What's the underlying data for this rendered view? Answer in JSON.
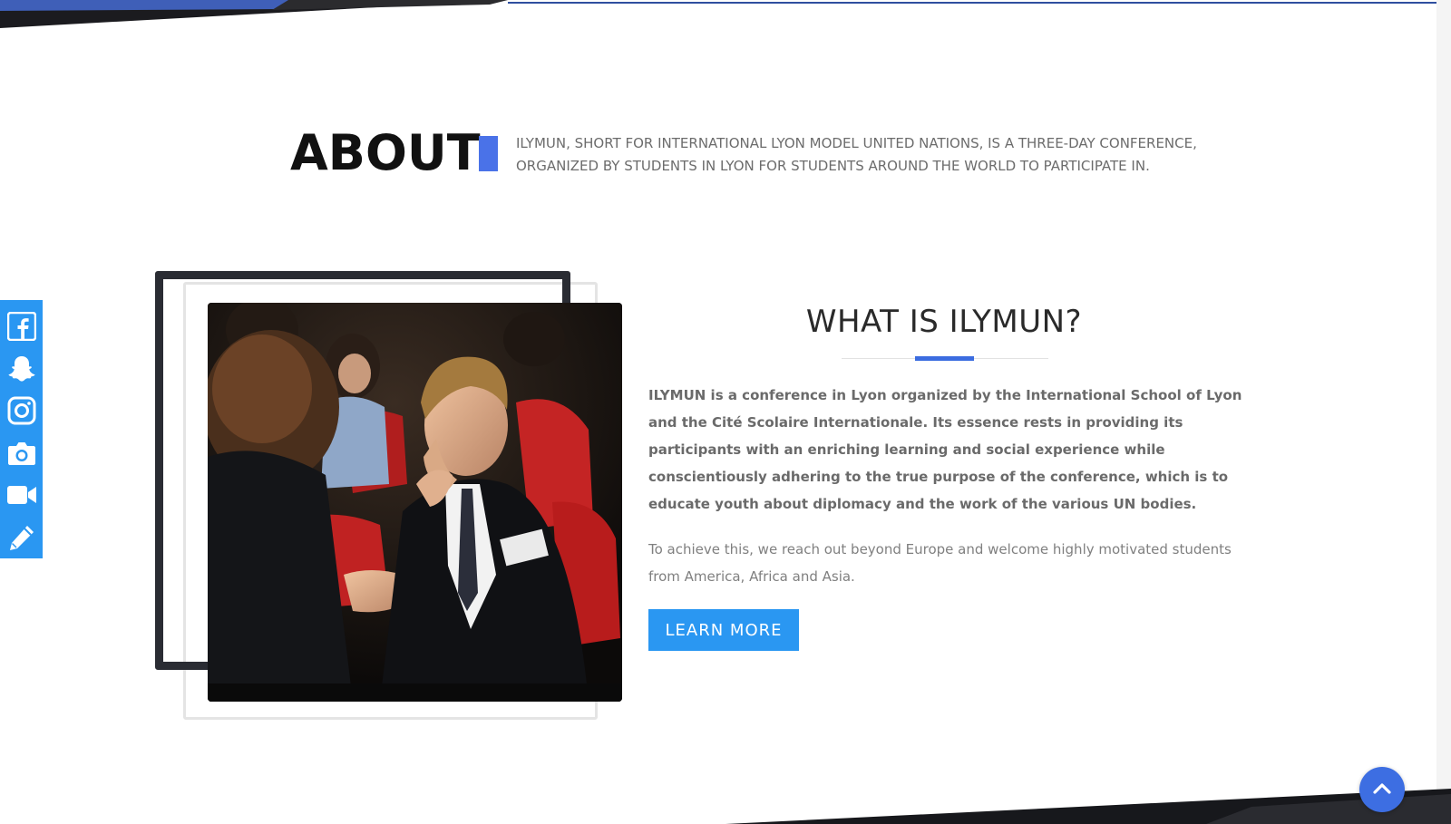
{
  "about": {
    "title": "ABOUT",
    "intro": "ILYMUN, SHORT FOR INTERNATIONAL LYON MODEL UNITED NATIONS, IS A THREE-DAY CONFERENCE, ORGANIZED BY STUDENTS IN LYON FOR STUDENTS AROUND THE WORLD TO PARTICIPATE IN."
  },
  "social": {
    "items": [
      {
        "name": "facebook-icon"
      },
      {
        "name": "snapchat-icon"
      },
      {
        "name": "instagram-icon"
      },
      {
        "name": "camera-icon"
      },
      {
        "name": "video-camera-icon"
      },
      {
        "name": "pencil-icon"
      }
    ]
  },
  "what": {
    "title": "WHAT IS ILYMUN?",
    "paragraph_bold": "ILYMUN is a conference in Lyon organized by the International School of Lyon and the Cité Scolaire Internationale. Its essence rests in providing its participants with an enriching learning and social experience while conscientiously adhering to the true purpose of the conference, which is to educate youth about diplomacy and the work of the various UN bodies.",
    "paragraph_light": "To achieve this, we reach out beyond Europe and welcome highly motivated students from America, Africa and Asia.",
    "button_label": "LEARN MORE"
  },
  "colors": {
    "accent_blue": "#4a72e8",
    "social_blue": "#2a97f2",
    "button_blue": "#2a97f2",
    "dark_frame": "#2a2c33"
  }
}
